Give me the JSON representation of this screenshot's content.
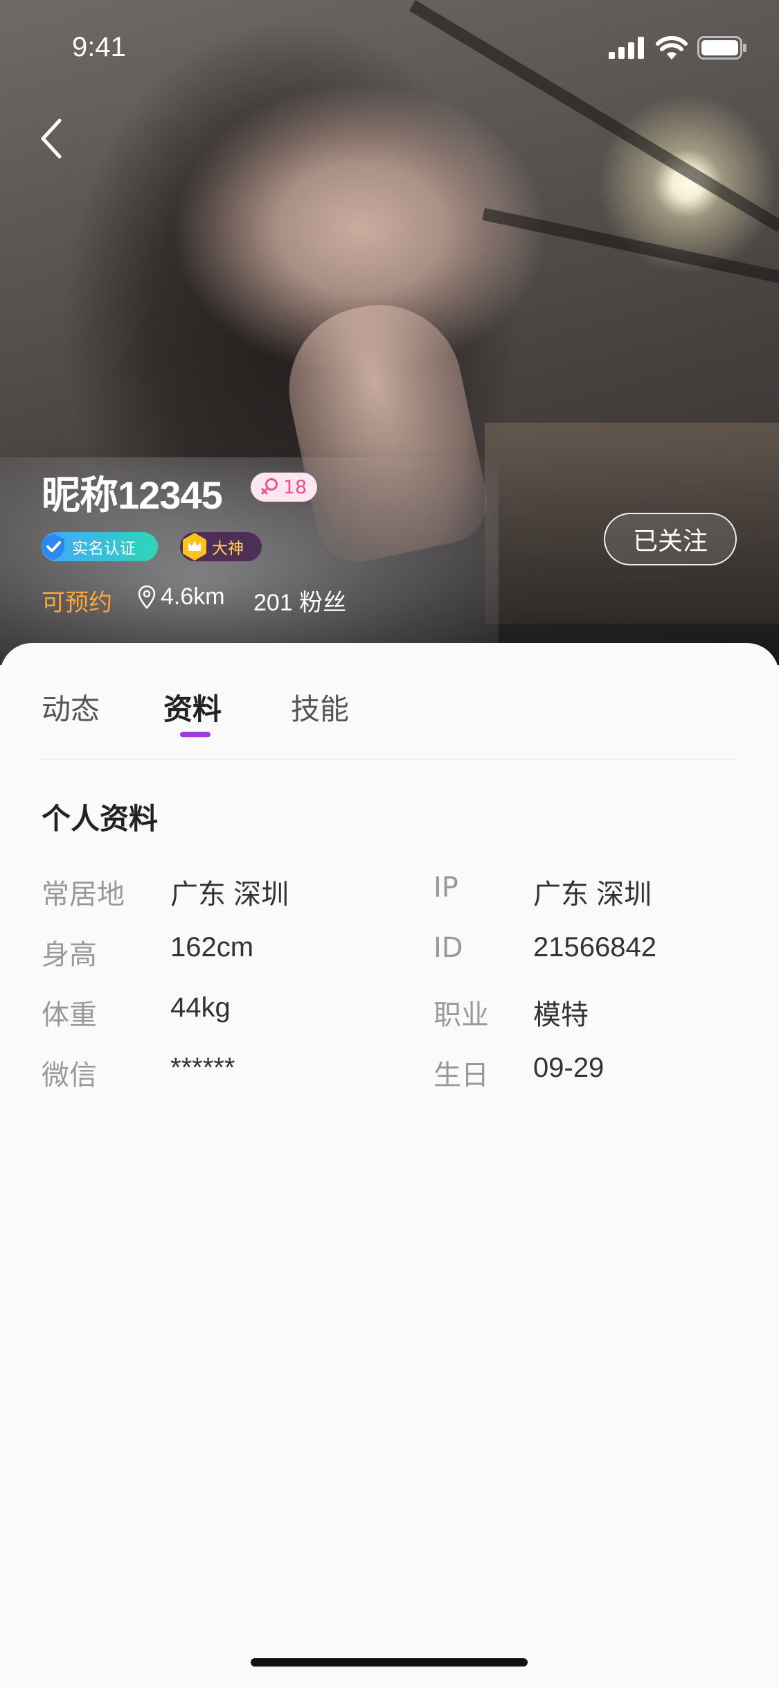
{
  "status_bar": {
    "time": "9:41"
  },
  "profile": {
    "nickname": "昵称12345",
    "age": "18",
    "badges": {
      "verified": "实名认证",
      "god": "大神"
    },
    "bookable": "可预约",
    "distance": "4.6km",
    "fans": "201 粉丝",
    "follow_button": "已关注"
  },
  "tabs": [
    {
      "label": "动态"
    },
    {
      "label": "资料",
      "active": true
    },
    {
      "label": "技能"
    }
  ],
  "section_title": "个人资料",
  "info_rows": [
    {
      "left_label": "常居地",
      "left_value": "广东 深圳",
      "right_label": "IP",
      "right_value": "广东 深圳"
    },
    {
      "left_label": "身高",
      "left_value": "162cm",
      "right_label": "ID",
      "right_value": "21566842"
    },
    {
      "left_label": "体重",
      "left_value": "44kg",
      "right_label": "职业",
      "right_value": "模特"
    },
    {
      "left_label": "微信",
      "left_value": "******",
      "right_label": "生日",
      "right_value": "09-29"
    }
  ],
  "colors": {
    "accent_purple": "#9b3be0",
    "bookable_orange": "#ffa53a",
    "age_pink": "#e8558c"
  },
  "icons": [
    "back-icon",
    "signal-icon",
    "wifi-icon",
    "battery-icon",
    "female-icon",
    "shield-check-icon",
    "crown-icon",
    "location-pin-icon"
  ]
}
